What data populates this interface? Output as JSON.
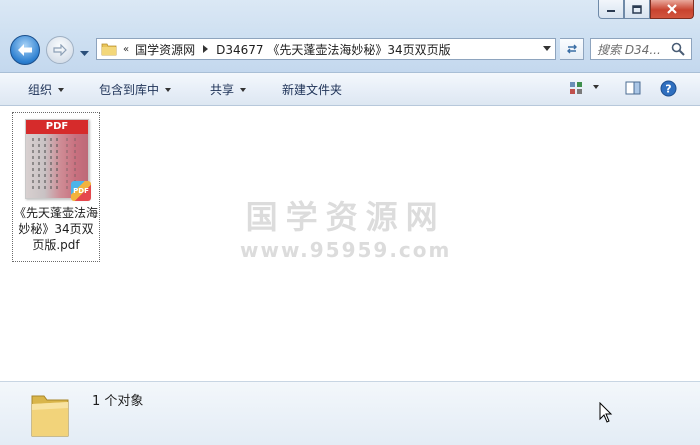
{
  "window": {
    "controls": [
      "minimize",
      "maximize",
      "close"
    ]
  },
  "address_bar": {
    "overflow_glyph": "«",
    "crumbs": [
      "国学资源网",
      "D34677 《先天蓬壶法海妙秘》34页双页版"
    ]
  },
  "search": {
    "placeholder": "搜索 D34..."
  },
  "toolbar": {
    "organize": "组织",
    "include_in_library": "包含到库中",
    "share": "共享",
    "new_folder": "新建文件夹"
  },
  "files": [
    {
      "name": "《先天蓬壶法海妙秘》34页双页版.pdf",
      "type": "pdf",
      "thumb_label": "PDF",
      "badge_label": "PDF"
    }
  ],
  "watermark": {
    "title": "国学资源网",
    "subtitle": "www.95959.com"
  },
  "details": {
    "count": "1 个对象"
  },
  "colors": {
    "accent": "#2c7fd0",
    "pdf_red": "#d62b2b",
    "watermark": "#dcdcdc"
  }
}
